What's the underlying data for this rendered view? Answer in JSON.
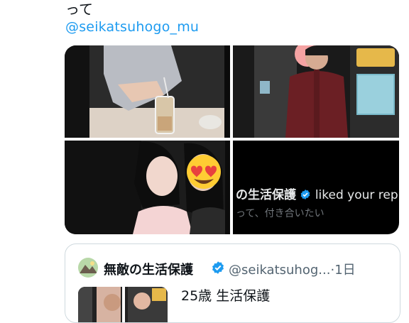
{
  "tweet": {
    "text_tail": "って",
    "mention": "@seikatsuhogo_mu"
  },
  "media": {
    "overlay_account": "の生活保護",
    "overlay_action": "liked your reply",
    "overlay_text": "って、付き合いたい",
    "emoji": "heart-eyes"
  },
  "quote_tweet": {
    "author_name": "無敵の生活保護",
    "handle": "@seikatsuhog...",
    "separator": "·",
    "time": "1日",
    "text": "25歳 生活保護"
  },
  "colors": {
    "link": "#1d9bf0",
    "verified": "#1d9bf0",
    "secondary_text": "#536471",
    "border": "#cfd9de"
  }
}
